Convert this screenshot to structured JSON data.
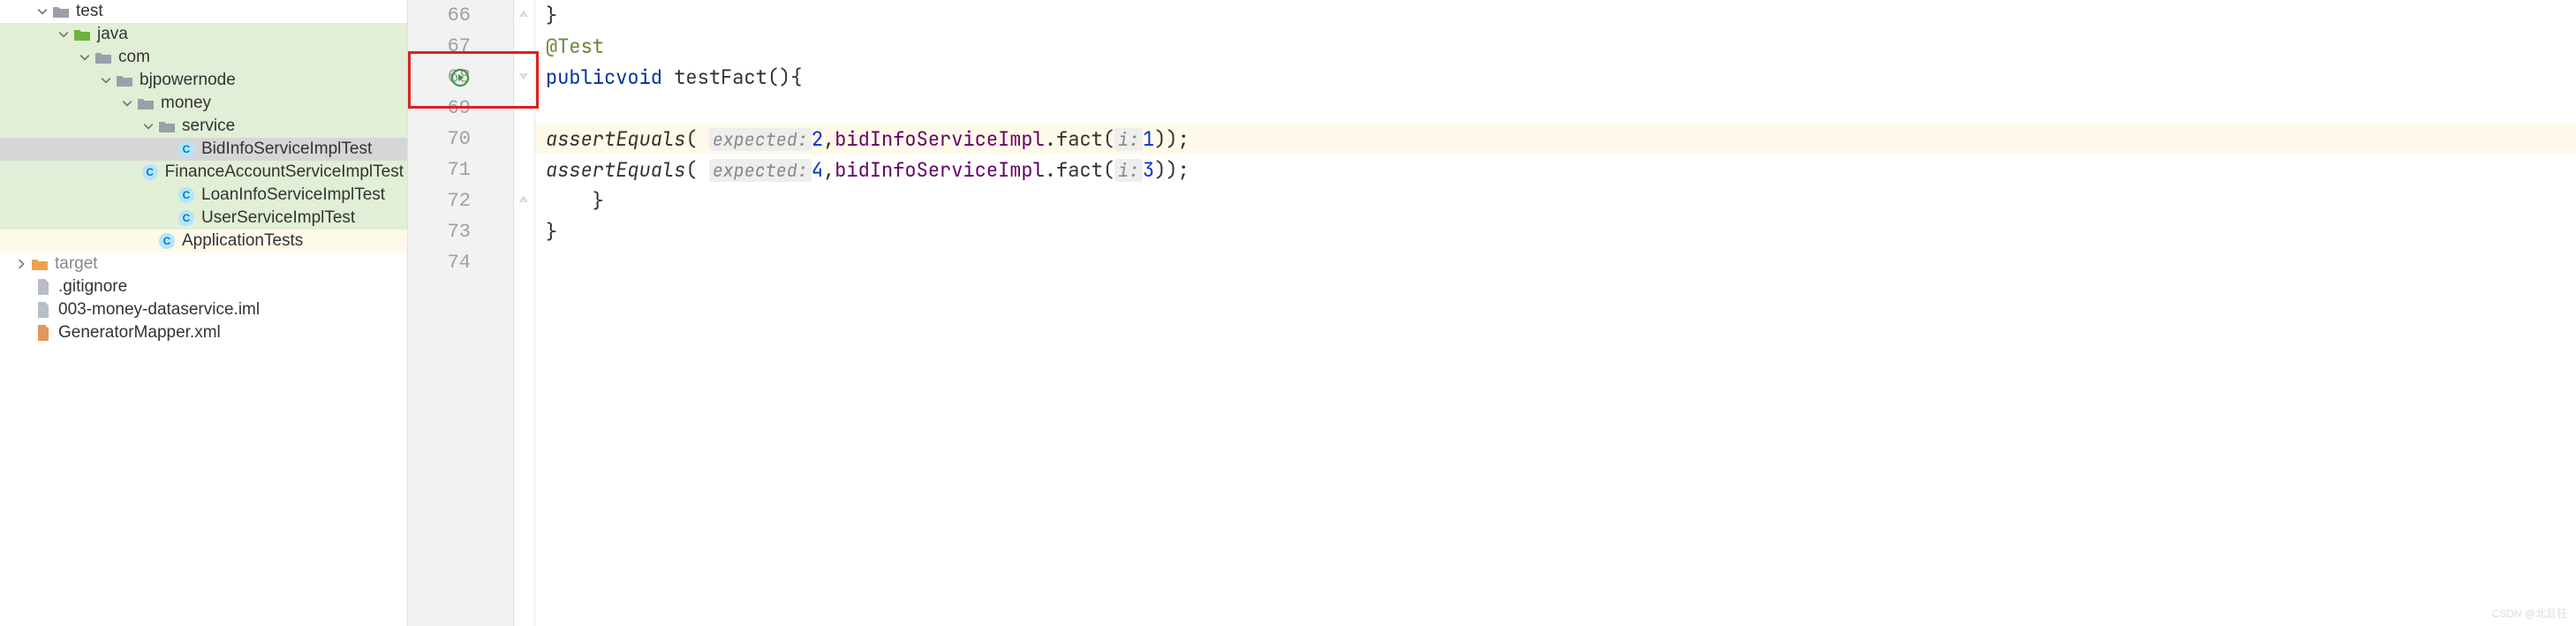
{
  "tree": {
    "test": "test",
    "java": "java",
    "com": "com",
    "bjpowernode": "bjpowernode",
    "money": "money",
    "service": "service",
    "bidInfo": "BidInfoServiceImplTest",
    "finance": "FinanceAccountServiceImplTest",
    "loan": "LoanInfoServiceImplTest",
    "user": "UserServiceImplTest",
    "appTests": "ApplicationTests",
    "target": "target",
    "gitignore": ".gitignore",
    "iml": "003-money-dataservice.iml",
    "genMapper": "GeneratorMapper.xml"
  },
  "gutter": {
    "l66": "66",
    "l67": "67",
    "l68": "68",
    "l69": "69",
    "l70": "70",
    "l71": "71",
    "l72": "72",
    "l73": "73",
    "l74": "74"
  },
  "code": {
    "brace_close": "}",
    "anno_test": "@Test",
    "public": "public",
    "void": "void",
    "method_sig": " testFact(){",
    "assertEquals": "assertEquals",
    "hint_expected": "expected:",
    "val_2": "2",
    "val_4": "4",
    "comma": ",",
    "bidInfoServiceImpl": "bidInfoServiceImpl",
    "dot_fact": ".fact(",
    "hint_i": "i:",
    "val_1": "1",
    "val_3": "3",
    "tail": "));",
    "indent_close": "    }",
    "indent_close2": "        }",
    "open_paren": "( "
  },
  "watermark": "CSDN @北且狂"
}
